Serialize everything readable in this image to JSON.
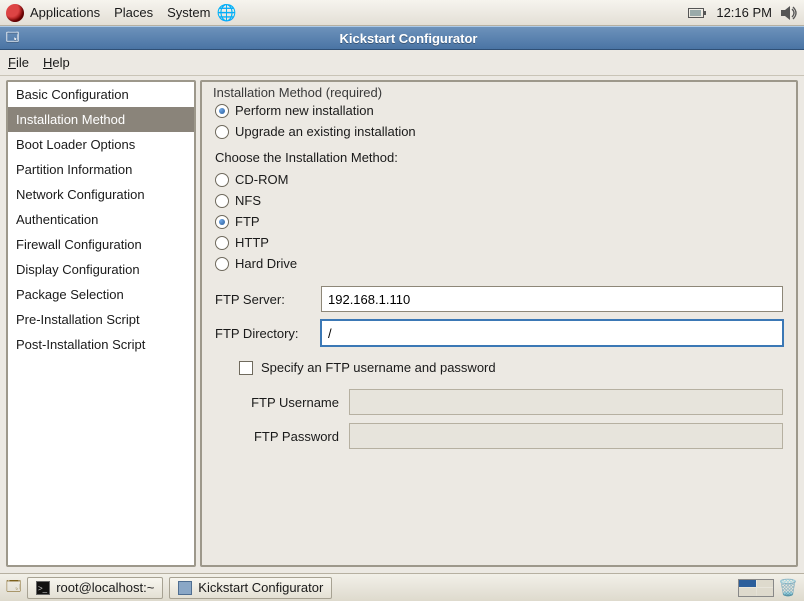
{
  "panel": {
    "menus": [
      "Applications",
      "Places",
      "System"
    ],
    "clock": "12:16 PM"
  },
  "window": {
    "title": "Kickstart Configurator",
    "menubar": {
      "file": "File",
      "help": "Help"
    }
  },
  "sidebar": {
    "items": [
      "Basic Configuration",
      "Installation Method",
      "Boot Loader Options",
      "Partition Information",
      "Network Configuration",
      "Authentication",
      "Firewall Configuration",
      "Display Configuration",
      "Package Selection",
      "Pre-Installation Script",
      "Post-Installation Script"
    ],
    "selectedIndex": 1
  },
  "install": {
    "group_label": "Installation Method (required)",
    "radio1": "Perform new installation",
    "radio2": "Upgrade an existing installation",
    "selected_type": "new",
    "method_heading": "Choose the Installation Method:",
    "methods": {
      "cdrom": "CD-ROM",
      "nfs": "NFS",
      "ftp": "FTP",
      "http": "HTTP",
      "hdd": "Hard Drive"
    },
    "selected_method": "ftp",
    "ftp": {
      "server_label": "FTP Server:",
      "dir_label": "FTP Directory:",
      "server_value": "192.168.1.110",
      "dir_value": "/",
      "auth_checkbox_label": "Specify an FTP username and password",
      "auth_checked": false,
      "user_label": "FTP Username",
      "pass_label": "FTP Password",
      "user_value": "",
      "pass_value": ""
    }
  },
  "taskbar": {
    "task1": "root@localhost:~",
    "task2": "Kickstart Configurator"
  }
}
